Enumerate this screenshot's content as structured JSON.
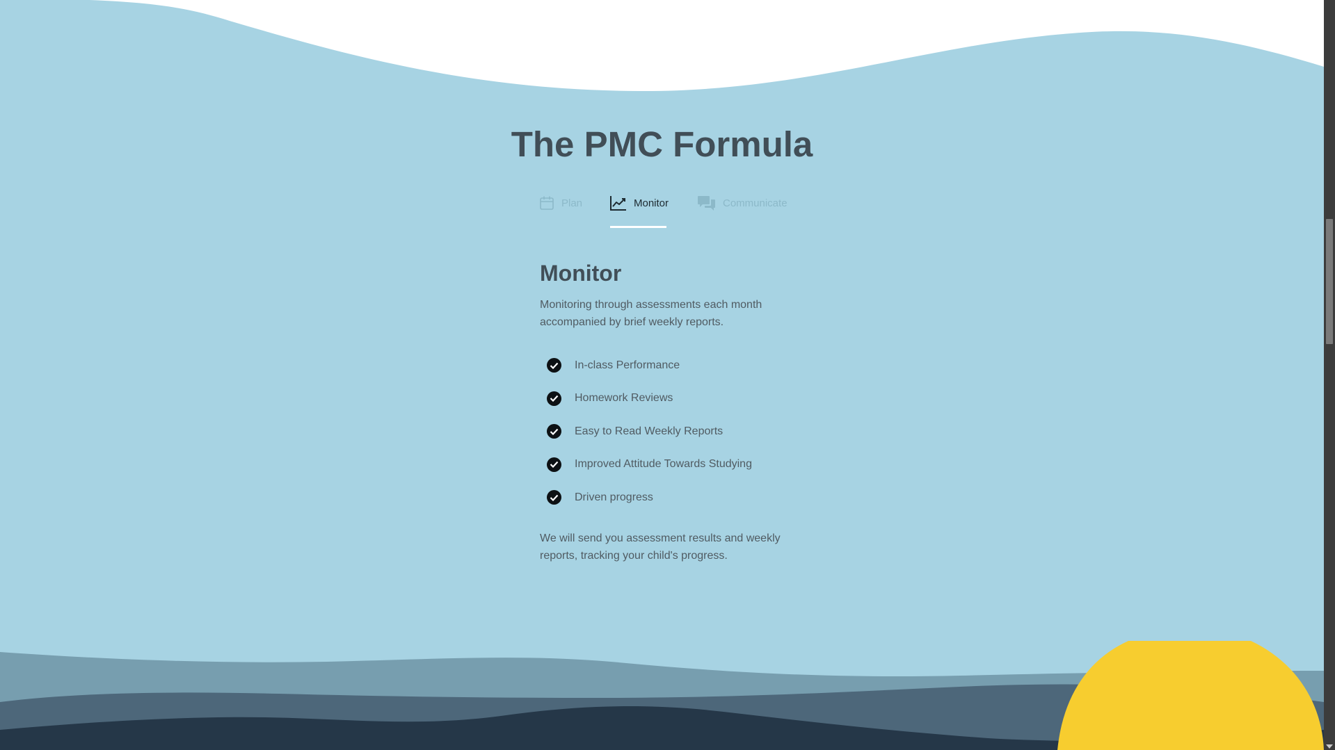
{
  "section": {
    "title": "The PMC Formula"
  },
  "tabs": [
    {
      "label": "Plan",
      "icon": "calendar-icon",
      "active": false
    },
    {
      "label": "Monitor",
      "icon": "line-chart-icon",
      "active": true
    },
    {
      "label": "Communicate",
      "icon": "chat-bubbles-icon",
      "active": false
    }
  ],
  "panel": {
    "heading": "Monitor",
    "intro": "Monitoring through assessments each month accompanied by brief weekly reports.",
    "items": [
      "In-class Performance",
      "Homework Reviews",
      "Easy to Read Weekly Reports",
      "Improved Attitude Towards Studying",
      "Driven progress"
    ],
    "closing": "We will send you assessment results and weekly reports, tracking your child's progress."
  },
  "colors": {
    "sky": "#a7d3e3",
    "wave_light": "#779eaf",
    "wave_mid": "#4d677a",
    "wave_dark": "#253748",
    "sun": "#f7cd2f",
    "title": "#414e57"
  }
}
